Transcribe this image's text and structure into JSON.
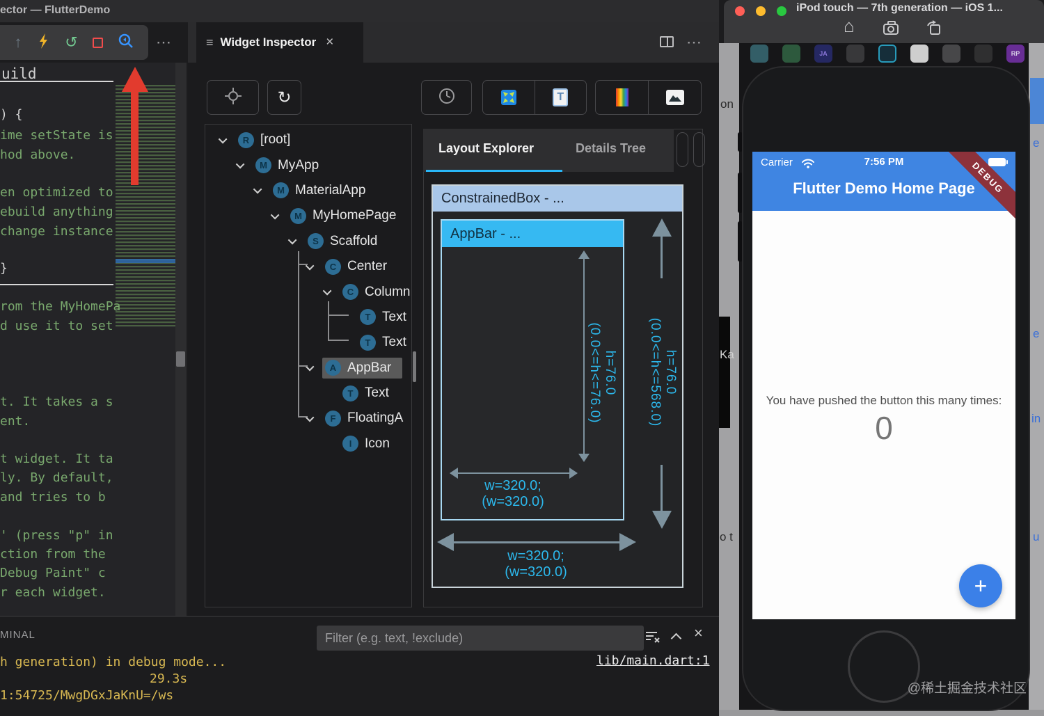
{
  "colors": {
    "accent_blue": "#3f85e2",
    "cyan": "#29b6f6",
    "box_header_blue": "#a9c7e9",
    "appbar_header_cyan": "#36b9f2",
    "ribbon_red": "#8d323b",
    "terminal_yellow": "#d9b952",
    "arrow_red": "#e23b2e",
    "badge_teal": "#2d6d94"
  },
  "vscode": {
    "title": "ector — FlutterDemo",
    "toolbar": {
      "step_up": "↑",
      "restart": "↺",
      "more": "⋯"
    },
    "editor": {
      "header": "uild",
      "lines": [
        {
          "t": ") {",
          "c": "plain"
        },
        {
          "t": "ime setState is",
          "c": "comment"
        },
        {
          "t": "hod above.",
          "c": "comment"
        },
        {
          "t": "en optimized to",
          "c": "comment"
        },
        {
          "t": "ebuild anything",
          "c": "comment"
        },
        {
          "t": "change instance",
          "c": "comment"
        },
        {
          "t": "}",
          "c": "plain"
        },
        {
          "t": "rom the MyHomePa",
          "c": "comment"
        },
        {
          "t": "d use it to set",
          "c": "comment"
        },
        {
          "t": "t. It takes a s",
          "c": "comment"
        },
        {
          "t": "ent.",
          "c": "comment"
        },
        {
          "t": "t widget. It ta",
          "c": "comment"
        },
        {
          "t": "ly. By default,",
          "c": "comment"
        },
        {
          "t": "and tries to b",
          "c": "comment"
        },
        {
          "t": "' (press \"p\" in",
          "c": "comment"
        },
        {
          "t": "ction from the",
          "c": "comment"
        },
        {
          "t": "Debug Paint\" c",
          "c": "comment"
        },
        {
          "t": "r each widget.",
          "c": "comment"
        }
      ]
    },
    "terminal": {
      "label": "MINAL",
      "filter_placeholder": "Filter (e.g. text, !exclude)",
      "line1": "h generation) in debug mode...",
      "line2": "29.3s",
      "line3": "1:54725/MwgDGxJaKnU=/ws",
      "link": "lib/main.dart:1"
    }
  },
  "inspector": {
    "tab_title": "Widget Inspector",
    "icons": {
      "menu": "≡",
      "close": "×",
      "more": "⋯",
      "refresh": "↻",
      "t_glyph": "T"
    },
    "tabs": {
      "layout": "Layout Explorer",
      "details": "Details Tree"
    },
    "tree": [
      {
        "label": "[root]",
        "badge": "R"
      },
      {
        "label": "MyApp",
        "badge": "M"
      },
      {
        "label": "MaterialApp",
        "badge": "M"
      },
      {
        "label": "MyHomePage",
        "badge": "M"
      },
      {
        "label": "Scaffold",
        "badge": "S"
      },
      {
        "label": "Center",
        "badge": "C"
      },
      {
        "label": "Column",
        "badge": "C"
      },
      {
        "label": "Text",
        "badge": "T"
      },
      {
        "label": "Text",
        "badge": "T"
      },
      {
        "label": "AppBar",
        "badge": "A"
      },
      {
        "label": "Text",
        "badge": "T"
      },
      {
        "label": "FloatingA",
        "badge": "F"
      },
      {
        "label": "Icon",
        "badge": "I"
      }
    ],
    "explorer": {
      "outer_title": "ConstrainedBox - ...",
      "inner_title": "AppBar - ...",
      "inner_h_line1": "h=76.0",
      "inner_h_line2": "(0.0<=h<=76.0)",
      "outer_h_line1": "h=76.0",
      "outer_h_line2": "(0.0<=h<=568.0)",
      "inner_w_line1": "w=320.0;",
      "inner_w_line2": "(w=320.0)",
      "outer_w_line1": "w=320.0;",
      "outer_w_line2": "(w=320.0)"
    }
  },
  "sim": {
    "title": "iPod touch — 7th generation — iOS 1...",
    "dock": [
      {
        "label": ""
      },
      {
        "label": ""
      },
      {
        "label": "JA"
      },
      {
        "label": ""
      },
      {
        "label": ""
      },
      {
        "label": ""
      },
      {
        "label": ""
      },
      {
        "label": ""
      },
      {
        "label": "RP"
      }
    ],
    "fragments": {
      "left1": "on",
      "left2": "Ka",
      "left3": "o t",
      "right1": "e",
      "right2": "e",
      "right3": "in",
      "right4": "u"
    },
    "phone": {
      "carrier": "Carrier",
      "time": "7:56 PM",
      "debug": "DEBUG",
      "appbar_title": "Flutter Demo Home Page",
      "body_text": "You have pushed the button this many times:",
      "counter": "0",
      "fab": "+",
      "watermark": "@稀土掘金技术社区"
    }
  }
}
